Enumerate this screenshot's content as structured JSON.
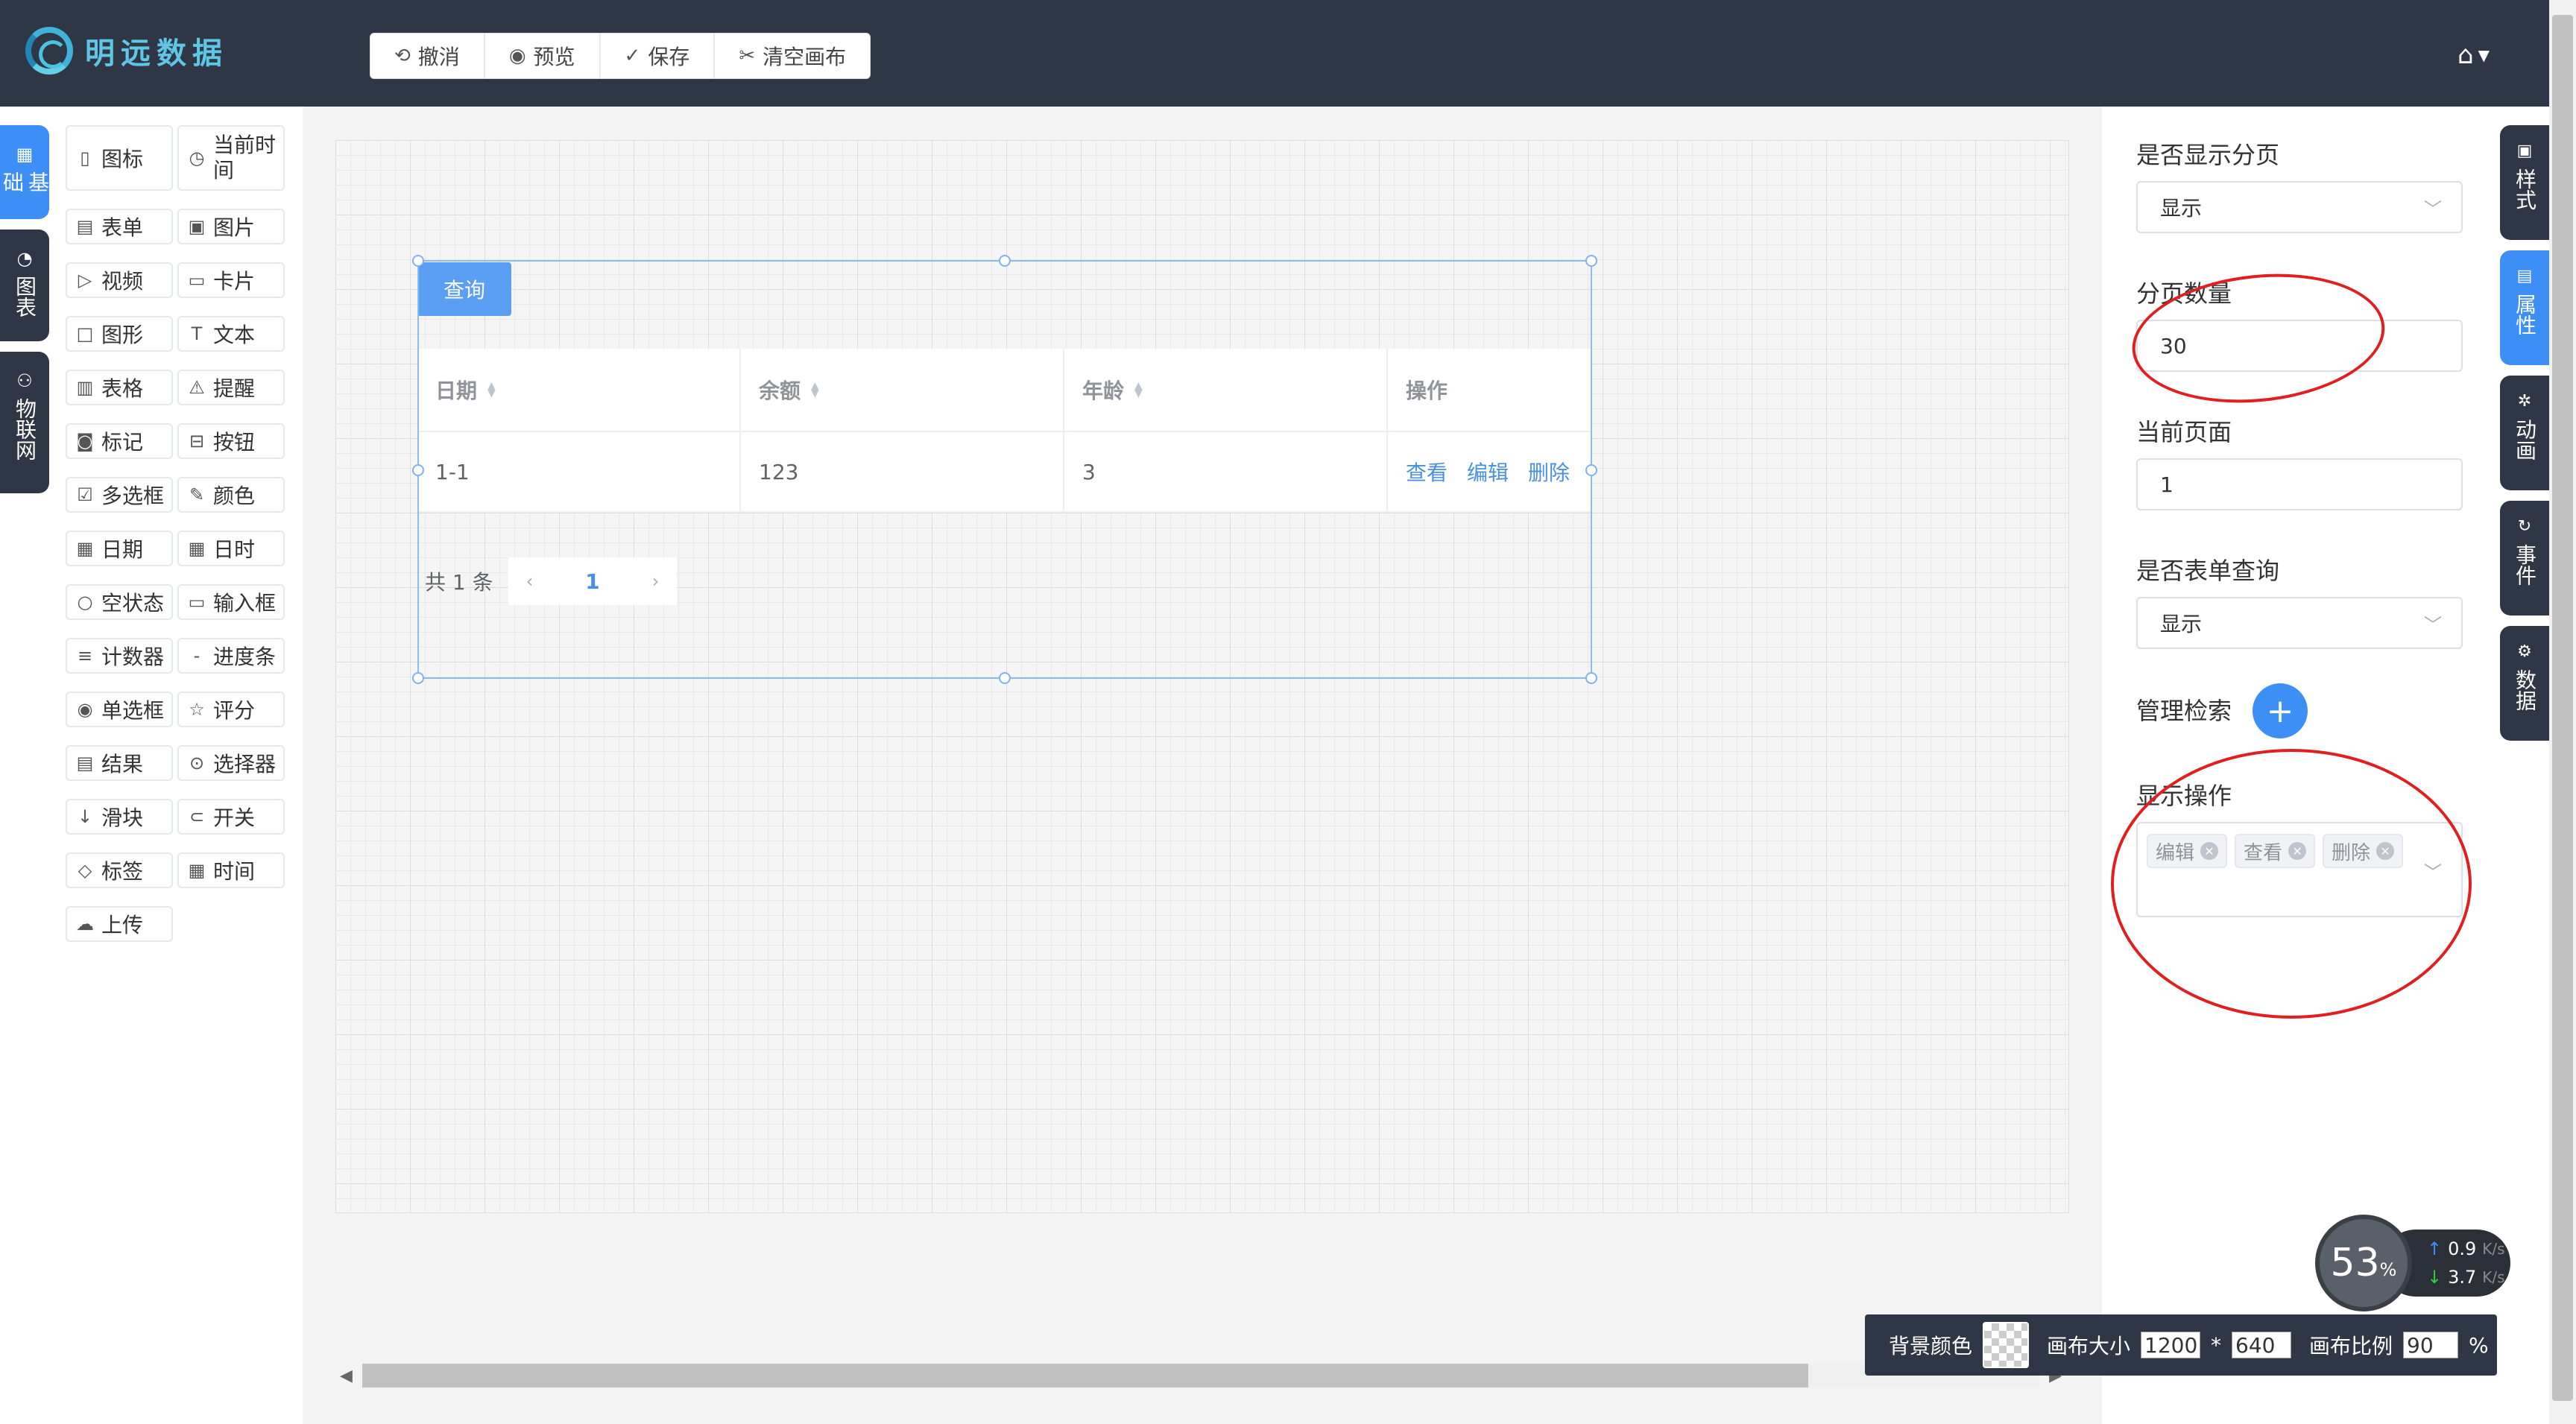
{
  "header": {
    "logo_text": "明远数据",
    "toolbar": [
      {
        "icon": "undo-icon",
        "glyph": "⟲",
        "label": "撤消"
      },
      {
        "icon": "eye-icon",
        "glyph": "◉",
        "label": "预览"
      },
      {
        "icon": "save-icon",
        "glyph": "✓",
        "label": "保存"
      },
      {
        "icon": "scissors-icon",
        "glyph": "✂",
        "label": "清空画布"
      }
    ],
    "home_icon": "home-icon"
  },
  "left_tabs": [
    {
      "label": "基础",
      "glyph": "▦",
      "active": true
    },
    {
      "label": "图表",
      "glyph": "◔",
      "active": false
    },
    {
      "label": "物联网",
      "glyph": "⚇",
      "active": false
    }
  ],
  "components": [
    {
      "label": "图标",
      "glyph": "▯"
    },
    {
      "label": "当前时间",
      "glyph": "◷"
    },
    {
      "label": "表单",
      "glyph": "▤"
    },
    {
      "label": "图片",
      "glyph": "▣"
    },
    {
      "label": "视频",
      "glyph": "▷"
    },
    {
      "label": "卡片",
      "glyph": "▭"
    },
    {
      "label": "图形",
      "glyph": "□"
    },
    {
      "label": "文本",
      "glyph": "T"
    },
    {
      "label": "表格",
      "glyph": "▥"
    },
    {
      "label": "提醒",
      "glyph": "⚠"
    },
    {
      "label": "标记",
      "glyph": "◙"
    },
    {
      "label": "按钮",
      "glyph": "⊟"
    },
    {
      "label": "多选框",
      "glyph": "☑"
    },
    {
      "label": "颜色",
      "glyph": "✎"
    },
    {
      "label": "日期",
      "glyph": "▦"
    },
    {
      "label": "日时",
      "glyph": "▦"
    },
    {
      "label": "空状态",
      "glyph": "○"
    },
    {
      "label": "输入框",
      "glyph": "▭"
    },
    {
      "label": "计数器",
      "glyph": "≡"
    },
    {
      "label": "进度条",
      "glyph": "-"
    },
    {
      "label": "单选框",
      "glyph": "◉"
    },
    {
      "label": "评分",
      "glyph": "☆"
    },
    {
      "label": "结果",
      "glyph": "▤"
    },
    {
      "label": "选择器",
      "glyph": "⊙"
    },
    {
      "label": "滑块",
      "glyph": "↓"
    },
    {
      "label": "开关",
      "glyph": "⊂"
    },
    {
      "label": "标签",
      "glyph": "◇"
    },
    {
      "label": "时间",
      "glyph": "▦"
    },
    {
      "label": "上传",
      "glyph": "☁"
    }
  ],
  "canvas": {
    "query_button": "查询",
    "table": {
      "headers": [
        "日期",
        "余额",
        "年龄",
        "操作"
      ],
      "rows": [
        {
          "date": "1-1",
          "amount": "123",
          "age": "3",
          "ops": [
            "查看",
            "编辑",
            "删除"
          ]
        }
      ]
    },
    "pager": {
      "total_text": "共 1 条",
      "current": "1"
    }
  },
  "properties": {
    "show_pagination_label": "是否显示分页",
    "show_pagination_value": "显示",
    "page_size_label": "分页数量",
    "page_size_value": "30",
    "current_page_label": "当前页面",
    "current_page_value": "1",
    "form_query_label": "是否表单查询",
    "form_query_value": "显示",
    "manage_search_label": "管理检索",
    "plus_label": "+",
    "show_ops_label": "显示操作",
    "show_ops_tags": [
      "编辑",
      "查看",
      "删除"
    ]
  },
  "right_tabs": [
    {
      "label": "样式",
      "glyph": "▣",
      "active": false
    },
    {
      "label": "属性",
      "glyph": "▤",
      "active": true
    },
    {
      "label": "动画",
      "glyph": "✲",
      "active": false
    },
    {
      "label": "事件",
      "glyph": "↻",
      "active": false
    },
    {
      "label": "数据",
      "glyph": "⚙",
      "active": false
    }
  ],
  "bottom_bar": {
    "bg_color_label": "背景颜色",
    "canvas_size_label": "画布大小",
    "width": "1200",
    "times": "*",
    "height": "640",
    "ratio_label": "画布比例",
    "ratio": "90",
    "percent": "%"
  },
  "net_widget": {
    "cpu": "53",
    "cpu_unit": "%",
    "up": "0.9",
    "down": "3.7",
    "unit": "K/s"
  }
}
